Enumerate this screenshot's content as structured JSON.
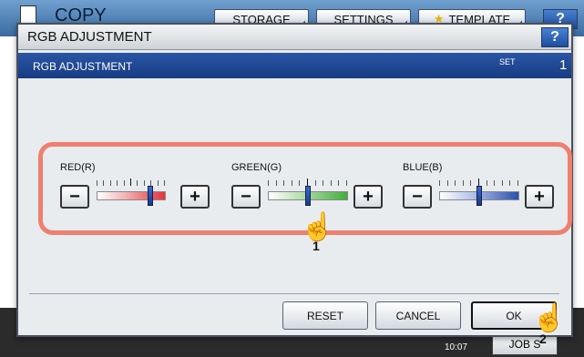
{
  "background": {
    "app_title": "COPY",
    "tabs": [
      {
        "label": "STORAGE"
      },
      {
        "label": "SETTINGS"
      },
      {
        "label": "TEMPLATE",
        "icon": "star-icon"
      }
    ],
    "help_label": "?",
    "time": "10:07",
    "job_status": "JOB S"
  },
  "dialog": {
    "title": "RGB ADJUSTMENT",
    "help_label": "?",
    "subtitle": "RGB ADJUSTMENT",
    "set_label": "SET",
    "set_value": "1",
    "channels": [
      {
        "name": "RED(R)",
        "minus": "−",
        "plus": "+",
        "level": 0.78,
        "color": "#e8333a"
      },
      {
        "name": "GREEN(G)",
        "minus": "−",
        "plus": "+",
        "level": 0.5,
        "color": "#3fae3a"
      },
      {
        "name": "BLUE(B)",
        "minus": "−",
        "plus": "+",
        "level": 0.5,
        "color": "#2a4fb0"
      }
    ],
    "buttons": {
      "reset": "RESET",
      "cancel": "CANCEL",
      "ok": "OK"
    }
  },
  "callouts": {
    "step1": "1",
    "step2": "2"
  },
  "colors": {
    "highlight": "#ef7f6e",
    "title_bar": "#1d4e9e"
  }
}
